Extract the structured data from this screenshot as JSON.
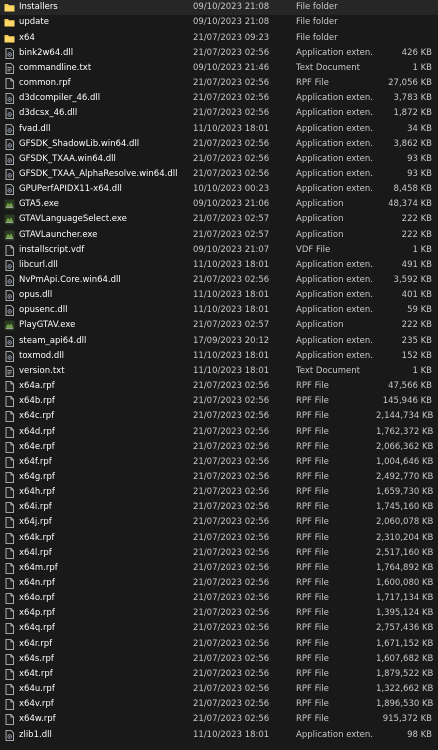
{
  "items": [
    {
      "name": "Installers",
      "date": "09/10/2023 21:08",
      "type": "File folder",
      "size": "",
      "icon": "folder-icon"
    },
    {
      "name": "update",
      "date": "09/10/2023 21:08",
      "type": "File folder",
      "size": "",
      "icon": "folder-icon"
    },
    {
      "name": "x64",
      "date": "21/07/2023 09:23",
      "type": "File folder",
      "size": "",
      "icon": "folder-icon"
    },
    {
      "name": "bink2w64.dll",
      "date": "21/07/2023 02:56",
      "type": "Application exten...",
      "size": "426 KB",
      "icon": "dll-file-icon"
    },
    {
      "name": "commandline.txt",
      "date": "09/10/2023 21:46",
      "type": "Text Document",
      "size": "1 KB",
      "icon": "text-file-icon"
    },
    {
      "name": "common.rpf",
      "date": "21/07/2023 02:56",
      "type": "RPF File",
      "size": "27,056 KB",
      "icon": "file-icon"
    },
    {
      "name": "d3dcompiler_46.dll",
      "date": "21/07/2023 02:56",
      "type": "Application exten...",
      "size": "3,783 KB",
      "icon": "dll-file-icon"
    },
    {
      "name": "d3dcsx_46.dll",
      "date": "21/07/2023 02:56",
      "type": "Application exten...",
      "size": "1,872 KB",
      "icon": "dll-file-icon"
    },
    {
      "name": "fvad.dll",
      "date": "11/10/2023 18:01",
      "type": "Application exten...",
      "size": "34 KB",
      "icon": "dll-file-icon"
    },
    {
      "name": "GFSDK_ShadowLib.win64.dll",
      "date": "21/07/2023 02:56",
      "type": "Application exten...",
      "size": "3,862 KB",
      "icon": "dll-file-icon"
    },
    {
      "name": "GFSDK_TXAA.win64.dll",
      "date": "21/07/2023 02:56",
      "type": "Application exten...",
      "size": "93 KB",
      "icon": "dll-file-icon"
    },
    {
      "name": "GFSDK_TXAA_AlphaResolve.win64.dll",
      "date": "21/07/2023 02:56",
      "type": "Application exten...",
      "size": "93 KB",
      "icon": "dll-file-icon"
    },
    {
      "name": "GPUPerfAPIDX11-x64.dll",
      "date": "10/10/2023 00:23",
      "type": "Application exten...",
      "size": "8,458 KB",
      "icon": "dll-file-icon"
    },
    {
      "name": "GTA5.exe",
      "date": "09/10/2023 21:06",
      "type": "Application",
      "size": "48,374 KB",
      "icon": "gta-app-icon"
    },
    {
      "name": "GTAVLanguageSelect.exe",
      "date": "21/07/2023 02:57",
      "type": "Application",
      "size": "222 KB",
      "icon": "gta-app-icon"
    },
    {
      "name": "GTAVLauncher.exe",
      "date": "21/07/2023 02:57",
      "type": "Application",
      "size": "222 KB",
      "icon": "gta-app-icon"
    },
    {
      "name": "installscript.vdf",
      "date": "09/10/2023 21:07",
      "type": "VDF File",
      "size": "1 KB",
      "icon": "file-icon"
    },
    {
      "name": "libcurl.dll",
      "date": "11/10/2023 18:01",
      "type": "Application exten...",
      "size": "491 KB",
      "icon": "dll-file-icon"
    },
    {
      "name": "NvPmApi.Core.win64.dll",
      "date": "21/07/2023 02:56",
      "type": "Application exten...",
      "size": "3,592 KB",
      "icon": "dll-file-icon"
    },
    {
      "name": "opus.dll",
      "date": "11/10/2023 18:01",
      "type": "Application exten...",
      "size": "401 KB",
      "icon": "dll-file-icon"
    },
    {
      "name": "opusenc.dll",
      "date": "11/10/2023 18:01",
      "type": "Application exten...",
      "size": "59 KB",
      "icon": "dll-file-icon"
    },
    {
      "name": "PlayGTAV.exe",
      "date": "21/07/2023 02:57",
      "type": "Application",
      "size": "222 KB",
      "icon": "gta-app-icon"
    },
    {
      "name": "steam_api64.dll",
      "date": "17/09/2023 20:12",
      "type": "Application exten...",
      "size": "235 KB",
      "icon": "dll-file-icon"
    },
    {
      "name": "toxmod.dll",
      "date": "11/10/2023 18:01",
      "type": "Application exten...",
      "size": "152 KB",
      "icon": "dll-file-icon"
    },
    {
      "name": "version.txt",
      "date": "11/10/2023 18:01",
      "type": "Text Document",
      "size": "1 KB",
      "icon": "text-file-icon"
    },
    {
      "name": "x64a.rpf",
      "date": "21/07/2023 02:56",
      "type": "RPF File",
      "size": "47,566 KB",
      "icon": "file-icon"
    },
    {
      "name": "x64b.rpf",
      "date": "21/07/2023 02:56",
      "type": "RPF File",
      "size": "145,946 KB",
      "icon": "file-icon"
    },
    {
      "name": "x64c.rpf",
      "date": "21/07/2023 02:56",
      "type": "RPF File",
      "size": "2,144,734 KB",
      "icon": "file-icon"
    },
    {
      "name": "x64d.rpf",
      "date": "21/07/2023 02:56",
      "type": "RPF File",
      "size": "1,762,372 KB",
      "icon": "file-icon"
    },
    {
      "name": "x64e.rpf",
      "date": "21/07/2023 02:56",
      "type": "RPF File",
      "size": "2,066,362 KB",
      "icon": "file-icon"
    },
    {
      "name": "x64f.rpf",
      "date": "21/07/2023 02:56",
      "type": "RPF File",
      "size": "1,004,646 KB",
      "icon": "file-icon"
    },
    {
      "name": "x64g.rpf",
      "date": "21/07/2023 02:56",
      "type": "RPF File",
      "size": "2,492,770 KB",
      "icon": "file-icon"
    },
    {
      "name": "x64h.rpf",
      "date": "21/07/2023 02:56",
      "type": "RPF File",
      "size": "1,659,730 KB",
      "icon": "file-icon"
    },
    {
      "name": "x64i.rpf",
      "date": "21/07/2023 02:56",
      "type": "RPF File",
      "size": "1,745,160 KB",
      "icon": "file-icon"
    },
    {
      "name": "x64j.rpf",
      "date": "21/07/2023 02:56",
      "type": "RPF File",
      "size": "2,060,078 KB",
      "icon": "file-icon"
    },
    {
      "name": "x64k.rpf",
      "date": "21/07/2023 02:56",
      "type": "RPF File",
      "size": "2,310,204 KB",
      "icon": "file-icon"
    },
    {
      "name": "x64l.rpf",
      "date": "21/07/2023 02:56",
      "type": "RPF File",
      "size": "2,517,160 KB",
      "icon": "file-icon"
    },
    {
      "name": "x64m.rpf",
      "date": "21/07/2023 02:56",
      "type": "RPF File",
      "size": "1,764,892 KB",
      "icon": "file-icon"
    },
    {
      "name": "x64n.rpf",
      "date": "21/07/2023 02:56",
      "type": "RPF File",
      "size": "1,600,080 KB",
      "icon": "file-icon"
    },
    {
      "name": "x64o.rpf",
      "date": "21/07/2023 02:56",
      "type": "RPF File",
      "size": "1,717,134 KB",
      "icon": "file-icon"
    },
    {
      "name": "x64p.rpf",
      "date": "21/07/2023 02:56",
      "type": "RPF File",
      "size": "1,395,124 KB",
      "icon": "file-icon"
    },
    {
      "name": "x64q.rpf",
      "date": "21/07/2023 02:56",
      "type": "RPF File",
      "size": "2,757,436 KB",
      "icon": "file-icon"
    },
    {
      "name": "x64r.rpf",
      "date": "21/07/2023 02:56",
      "type": "RPF File",
      "size": "1,671,152 KB",
      "icon": "file-icon"
    },
    {
      "name": "x64s.rpf",
      "date": "21/07/2023 02:56",
      "type": "RPF File",
      "size": "1,607,682 KB",
      "icon": "file-icon"
    },
    {
      "name": "x64t.rpf",
      "date": "21/07/2023 02:56",
      "type": "RPF File",
      "size": "1,879,522 KB",
      "icon": "file-icon"
    },
    {
      "name": "x64u.rpf",
      "date": "21/07/2023 02:56",
      "type": "RPF File",
      "size": "1,322,662 KB",
      "icon": "file-icon"
    },
    {
      "name": "x64v.rpf",
      "date": "21/07/2023 02:56",
      "type": "RPF File",
      "size": "1,896,530 KB",
      "icon": "file-icon"
    },
    {
      "name": "x64w.rpf",
      "date": "21/07/2023 02:56",
      "type": "RPF File",
      "size": "915,372 KB",
      "icon": "file-icon"
    },
    {
      "name": "zlib1.dll",
      "date": "11/10/2023 18:01",
      "type": "Application exten...",
      "size": "98 KB",
      "icon": "dll-file-icon"
    }
  ],
  "colors": {
    "background": "#191919",
    "name_text": "#ffffff",
    "meta_text": "#c8c8c8",
    "folder": "#f3c94b",
    "gta_icon": "#5a8a3a"
  }
}
